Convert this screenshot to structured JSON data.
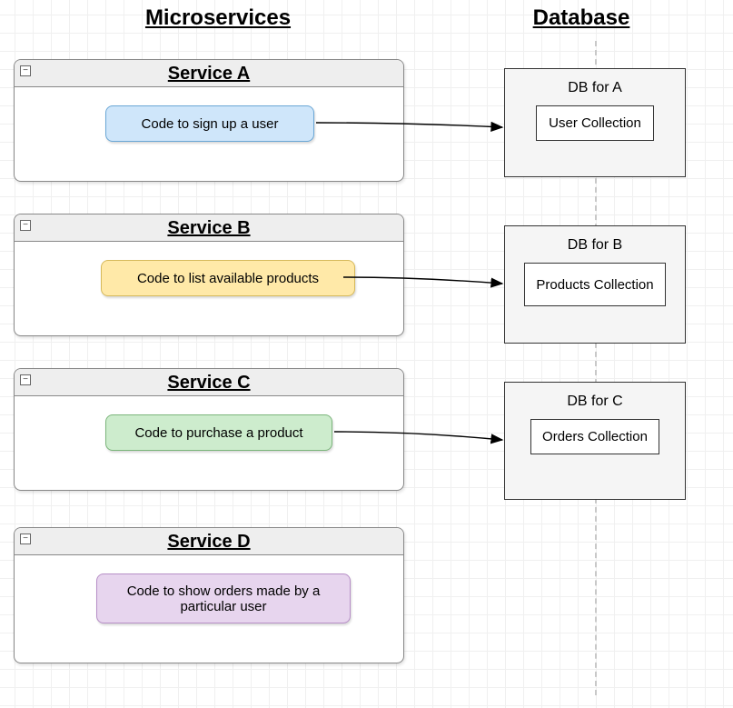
{
  "headings": {
    "microservices": "Microservices",
    "database": "Database"
  },
  "services": [
    {
      "title": "Service A",
      "code": "Code to sign up a user",
      "codeColor": {
        "bg": "#cfe6fa",
        "border": "#6aa7d6"
      }
    },
    {
      "title": "Service B",
      "code": "Code to list available products",
      "codeColor": {
        "bg": "#ffe9a8",
        "border": "#d6b95a"
      }
    },
    {
      "title": "Service C",
      "code": "Code to purchase a product",
      "codeColor": {
        "bg": "#cdeccd",
        "border": "#7bb57b"
      }
    },
    {
      "title": "Service D",
      "code": "Code to show orders made by a particular user",
      "codeColor": {
        "bg": "#e7d5ee",
        "border": "#b78fc7"
      }
    }
  ],
  "databases": [
    {
      "title": "DB for A",
      "collection": "User Collection"
    },
    {
      "title": "DB for B",
      "collection": "Products Collection"
    },
    {
      "title": "DB for C",
      "collection": "Orders Collection"
    }
  ],
  "collapseGlyph": "−"
}
